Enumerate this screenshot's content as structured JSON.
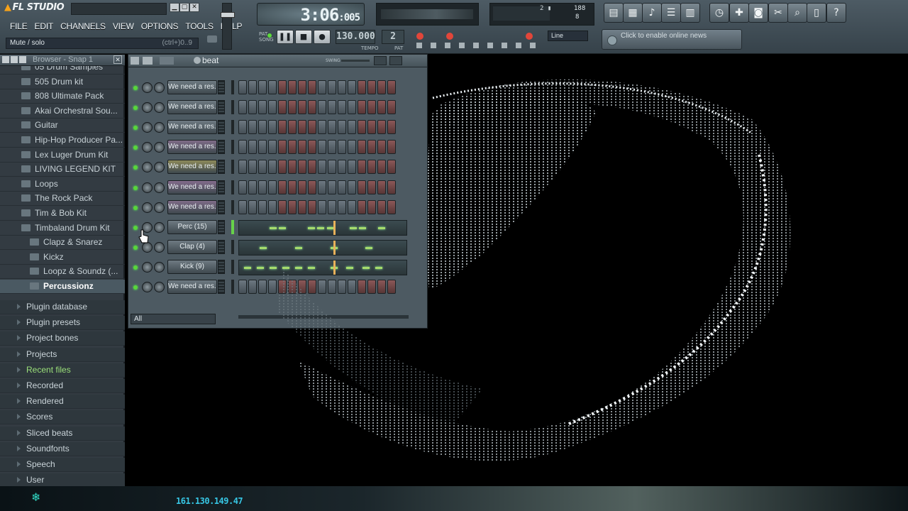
{
  "app": {
    "title": "FL STUDIO"
  },
  "menu": [
    "FILE",
    "EDIT",
    "CHANNELS",
    "VIEW",
    "OPTIONS",
    "TOOLS",
    "HELP"
  ],
  "hint": {
    "text": "Mute / solo",
    "shortcut": "(ctrl+)0..9"
  },
  "transport": {
    "time": "3:06",
    "time_frac": ":005",
    "tempo": "130.000",
    "pattern": "2",
    "snap": "Line",
    "tempo_label": "TEMPO",
    "pattern_label": "PAT"
  },
  "news": {
    "text": "Click to enable online news"
  },
  "browser": {
    "title": "Browser - Snap 1",
    "items": [
      {
        "label": "05 Drum Samples",
        "level": 1
      },
      {
        "label": "505 Drum kit",
        "level": 1
      },
      {
        "label": "808 Ultimate Pack",
        "level": 1
      },
      {
        "label": "Akai Orchestral Sou...",
        "level": 1
      },
      {
        "label": "Guitar",
        "level": 1
      },
      {
        "label": "Hip-Hop Producer Pa...",
        "level": 1
      },
      {
        "label": "Lex Luger Drum Kit",
        "level": 1
      },
      {
        "label": "LIVING LEGEND KIT",
        "level": 1
      },
      {
        "label": "Loops",
        "level": 1
      },
      {
        "label": "The Rock Pack",
        "level": 1
      },
      {
        "label": "Tim & Bob Kit",
        "level": 1
      },
      {
        "label": "Timbaland Drum Kit",
        "level": 1
      },
      {
        "label": "Clapz & Snarez",
        "level": 2
      },
      {
        "label": "Kickz",
        "level": 2
      },
      {
        "label": "Loopz & Soundz (...",
        "level": 2
      },
      {
        "label": "Percussionz",
        "level": 2,
        "selected": true
      }
    ],
    "categories": [
      "Plugin database",
      "Plugin presets",
      "Project bones",
      "Projects",
      "Recent files",
      "Recorded",
      "Rendered",
      "Scores",
      "Sliced beats",
      "Soundfonts",
      "Speech",
      "User"
    ]
  },
  "sequencer": {
    "pattern_name": "beat",
    "swing_label": "SWING",
    "filter": "All",
    "channels": [
      {
        "name": "We need a res...",
        "color": "#6e7a82",
        "mode": "steps",
        "steps": "a"
      },
      {
        "name": "We need a res...",
        "color": "#6e7a82",
        "mode": "steps",
        "steps": "b"
      },
      {
        "name": "We need a res...",
        "color": "#6e7a82",
        "mode": "steps",
        "steps": "b"
      },
      {
        "name": "We need a res...",
        "color": "#7f6c88",
        "mode": "steps",
        "steps": "b"
      },
      {
        "name": "We need a res...",
        "color": "#8d8a5a",
        "mode": "steps",
        "steps": "a"
      },
      {
        "name": "We need a res...",
        "color": "#846c8c",
        "mode": "steps",
        "steps": "b"
      },
      {
        "name": "We need a res...",
        "color": "#7f6c88",
        "mode": "steps",
        "steps": "b"
      },
      {
        "name": "Perc (15)",
        "color": "#6e7a82",
        "mode": "roll",
        "notes": [
          0.18,
          0.24,
          0.42,
          0.48,
          0.54,
          0.68,
          0.74,
          0.86
        ]
      },
      {
        "name": "Clap (4)",
        "color": "#6e7a82",
        "mode": "roll",
        "notes": [
          0.12,
          0.34,
          0.56,
          0.78
        ]
      },
      {
        "name": "Kick (9)",
        "color": "#6e7a82",
        "mode": "roll",
        "notes": [
          0.02,
          0.1,
          0.18,
          0.26,
          0.34,
          0.42,
          0.56,
          0.66,
          0.76,
          0.84
        ]
      },
      {
        "name": "We need a res...",
        "color": "#6e7a82",
        "mode": "steps",
        "steps": "b"
      }
    ]
  },
  "status": {
    "ip": "161.130.149.47"
  }
}
